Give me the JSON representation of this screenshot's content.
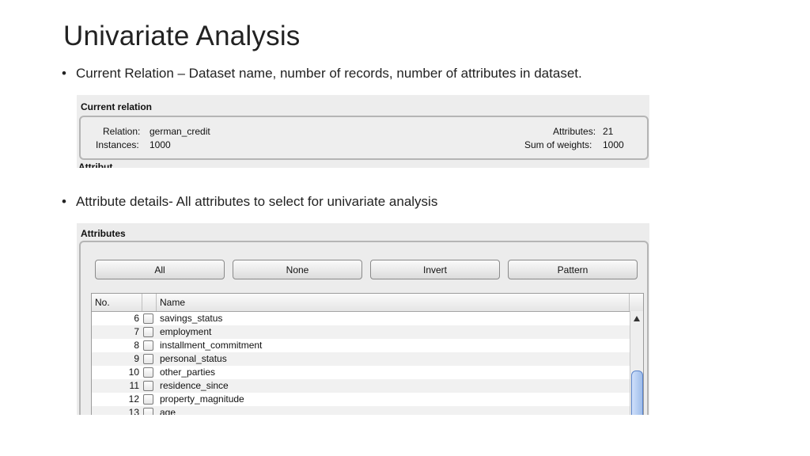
{
  "slide": {
    "title": "Univariate Analysis",
    "bullets": [
      "Current Relation – Dataset name, number of records, number of attributes in dataset.",
      "Attribute details- All attributes to select for univariate analysis"
    ],
    "bullet_glyph": "•"
  },
  "current_relation": {
    "heading": "Current relation",
    "relation_label": "Relation:",
    "relation_value": "german_credit",
    "instances_label": "Instances:",
    "instances_value": "1000",
    "attributes_label": "Attributes:",
    "attributes_value": "21",
    "weights_label": "Sum of weights:",
    "weights_value": "1000",
    "cut_off_text": "Attribut"
  },
  "attributes": {
    "heading": "Attributes",
    "buttons": {
      "all": "All",
      "none": "None",
      "invert": "Invert",
      "pattern": "Pattern"
    },
    "columns": {
      "no": "No.",
      "name": "Name"
    },
    "rows": [
      {
        "no": "6",
        "name": "savings_status"
      },
      {
        "no": "7",
        "name": "employment"
      },
      {
        "no": "8",
        "name": "installment_commitment"
      },
      {
        "no": "9",
        "name": "personal_status"
      },
      {
        "no": "10",
        "name": "other_parties"
      },
      {
        "no": "11",
        "name": "residence_since"
      },
      {
        "no": "12",
        "name": "property_magnitude"
      },
      {
        "no": "13",
        "name": "age"
      }
    ]
  },
  "icons": [
    "scroll-up-arrow-icon",
    "checkbox-icon"
  ]
}
